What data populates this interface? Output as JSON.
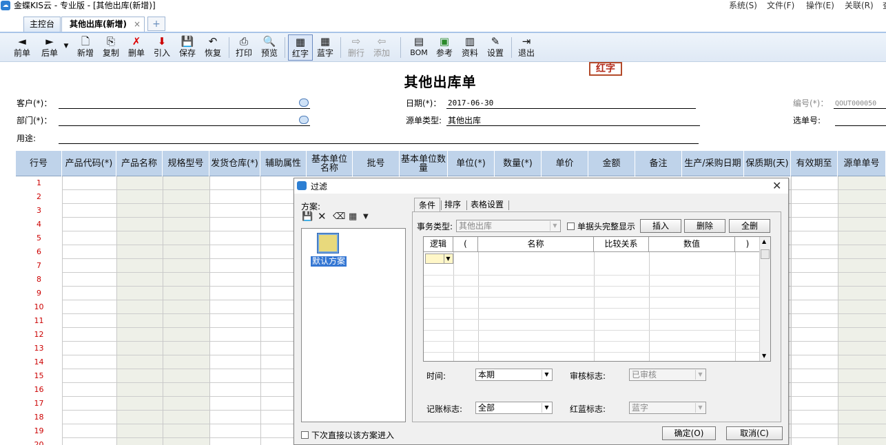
{
  "app": {
    "title": "金蝶KIS云 - 专业版 - [其他出库(新增)]",
    "menus": [
      "系统(S)",
      "文件(F)",
      "操作(E)",
      "关联(R)",
      "查"
    ]
  },
  "tabs": {
    "home": "主控台",
    "active": "其他出库(新增)",
    "close_glyph": "×",
    "add_glyph": "+"
  },
  "toolbar": [
    {
      "label": "前单",
      "icon": "◄"
    },
    {
      "label": "后单",
      "icon": "►"
    },
    {
      "label": "新增",
      "icon": "🗋"
    },
    {
      "label": "复制",
      "icon": "⎘"
    },
    {
      "label": "删单",
      "icon": "✗"
    },
    {
      "label": "引入",
      "icon": "⬇"
    },
    {
      "label": "保存",
      "icon": "💾"
    },
    {
      "label": "恢复",
      "icon": "↶"
    },
    {
      "label": "打印",
      "icon": "⎙"
    },
    {
      "label": "预览",
      "icon": "🔍"
    },
    {
      "label": "红字",
      "icon": "▦"
    },
    {
      "label": "蓝字",
      "icon": "▦"
    },
    {
      "label": "删行",
      "icon": "⇨"
    },
    {
      "label": "添加",
      "icon": "⇦"
    },
    {
      "label": "BOM",
      "icon": "▤"
    },
    {
      "label": "参考",
      "icon": "▣"
    },
    {
      "label": "资料",
      "icon": "▥"
    },
    {
      "label": "设置",
      "icon": "✎"
    },
    {
      "label": "退出",
      "icon": "⇥"
    }
  ],
  "document": {
    "title": "其他出库单",
    "stamp": "红字",
    "customer_label": "客户(*)：",
    "dept_label": "部门(*)：",
    "purpose_label": "用途:",
    "date_label": "日期(*)：",
    "date_value": "2017-06-30",
    "source_type_label": "源单类型:",
    "source_type_value": "其他出库",
    "number_label": "编号(*)：",
    "number_value": "QOUT000050",
    "select_no_label": "选单号:"
  },
  "grid": {
    "headers": [
      "行号",
      "产品代码(*)",
      "产品名称",
      "规格型号",
      "发货仓库(*)",
      "辅助属性",
      "基本单位名称",
      "批号",
      "基本单位数量",
      "单位(*)",
      "数量(*)",
      "单价",
      "金额",
      "备注",
      "生产/采购日期",
      "保质期(天)",
      "有效期至",
      "源单单号"
    ],
    "row_numbers": [
      "1",
      "2",
      "3",
      "4",
      "5",
      "6",
      "7",
      "8",
      "9",
      "10",
      "11",
      "12",
      "13",
      "14",
      "15",
      "16",
      "17",
      "18",
      "19",
      "20"
    ]
  },
  "dialog": {
    "title": "过滤",
    "close_glyph": "✕",
    "scheme_label": "方案:",
    "scheme_name": "默认方案",
    "direct_checkbox": "下次直接以该方案进入",
    "tabs": [
      "条件",
      "排序",
      "表格设置"
    ],
    "biz_type_label": "事务类型:",
    "biz_type_value": "其他出库",
    "full_display_label": "单据头完整显示",
    "buttons": {
      "insert": "插入",
      "delete": "删除",
      "clear_all": "全删",
      "ok": "确定(O)",
      "cancel": "取消(C)"
    },
    "cond_headers": [
      "逻辑",
      "(",
      "名称",
      "比较关系",
      "数值",
      ")"
    ],
    "time_label": "时间:",
    "time_value": "本期",
    "audit_label": "审核标志:",
    "audit_value": "已审核",
    "post_label": "记账标志:",
    "post_value": "全部",
    "redblue_label": "红蓝标志:",
    "redblue_value": "蓝字"
  }
}
